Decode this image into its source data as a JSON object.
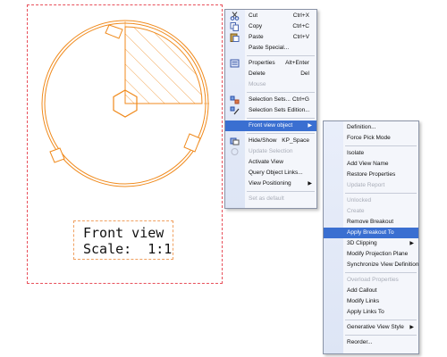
{
  "drawing": {
    "view_label_line1": "Front view",
    "view_label_line2": "Scale:  1:1",
    "colors": {
      "geometry": "#f08a1c",
      "frame": "#e8505b"
    }
  },
  "context_menu": {
    "items": [
      {
        "label": "Cut",
        "shortcut": "Ctrl+X",
        "icon": "scissors-icon",
        "enabled": true
      },
      {
        "label": "Copy",
        "shortcut": "Ctrl+C",
        "icon": "copy-icon",
        "enabled": true
      },
      {
        "label": "Paste",
        "shortcut": "Ctrl+V",
        "icon": "paste-icon",
        "enabled": true
      },
      {
        "label": "Paste Special...",
        "shortcut": "",
        "icon": "",
        "enabled": true
      },
      {
        "label": "Properties",
        "shortcut": "Alt+Enter",
        "icon": "properties-icon",
        "enabled": true
      },
      {
        "label": "Delete",
        "shortcut": "Del",
        "icon": "",
        "enabled": true
      },
      {
        "label": "Mouse",
        "shortcut": "",
        "icon": "",
        "enabled": false
      },
      {
        "label": "Selection Sets...",
        "shortcut": "Ctrl+G",
        "icon": "selection-sets-icon",
        "enabled": true
      },
      {
        "label": "Selection Sets Edition...",
        "shortcut": "",
        "icon": "selection-sets-edit-icon",
        "enabled": true
      },
      {
        "label": "Front view object",
        "shortcut": "",
        "icon": "",
        "enabled": true,
        "highlighted": true,
        "submenu": true
      },
      {
        "label": "Hide/Show",
        "shortcut": "KP_Space",
        "icon": "hide-show-icon",
        "enabled": true
      },
      {
        "label": "Update Selection",
        "shortcut": "",
        "icon": "update-icon",
        "enabled": false
      },
      {
        "label": "Activate View",
        "shortcut": "",
        "icon": "",
        "enabled": true
      },
      {
        "label": "Query Object Links...",
        "shortcut": "",
        "icon": "",
        "enabled": true
      },
      {
        "label": "View Positioning",
        "shortcut": "",
        "icon": "",
        "enabled": true,
        "submenu": true
      },
      {
        "label": "Set as default",
        "shortcut": "",
        "icon": "",
        "enabled": false
      }
    ]
  },
  "submenu": {
    "items": [
      {
        "label": "Definition...",
        "enabled": true
      },
      {
        "label": "Force Pick Mode",
        "enabled": true
      },
      {
        "label": "Isolate",
        "enabled": true
      },
      {
        "label": "Add View Name",
        "enabled": true
      },
      {
        "label": "Restore Properties",
        "enabled": true
      },
      {
        "label": "Update Report",
        "enabled": false
      },
      {
        "label": "Unlocked",
        "enabled": false
      },
      {
        "label": "Create",
        "enabled": false
      },
      {
        "label": "Remove Breakout",
        "enabled": true
      },
      {
        "label": "Apply Breakout To",
        "enabled": true,
        "highlighted": true
      },
      {
        "label": "3D Clipping",
        "enabled": true,
        "submenu": true
      },
      {
        "label": "Modify Projection Plane",
        "enabled": true
      },
      {
        "label": "Synchronize View Definition",
        "enabled": true
      },
      {
        "label": "Overload Properties",
        "enabled": false
      },
      {
        "label": "Add Callout",
        "enabled": true
      },
      {
        "label": "Modify Links",
        "enabled": true
      },
      {
        "label": "Apply Links To",
        "enabled": true
      },
      {
        "label": "Generative View Style",
        "enabled": true,
        "submenu": true
      },
      {
        "label": "Reorder...",
        "enabled": true
      }
    ]
  }
}
